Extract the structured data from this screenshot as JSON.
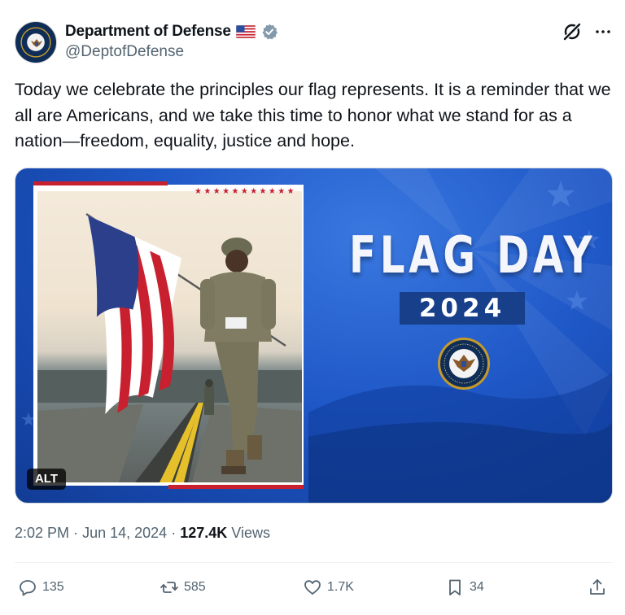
{
  "account": {
    "display_name": "Department of Defense",
    "handle": "@DeptofDefense",
    "flag_emoji_icon": "us-flag-icon",
    "verified_icon": "verified-badge-icon",
    "verified_color": "#829aab"
  },
  "tweet": {
    "text": "Today we celebrate the principles our flag represents. It is a reminder that we all are Americans, and we take this time to honor what we stand for as a nation—freedom, equality, justice and hope."
  },
  "media": {
    "headline": "FLAG DAY",
    "year": "2024",
    "alt_label": "ALT",
    "background_color": "#1f58c7",
    "seal_icon": "dod-seal-icon"
  },
  "meta": {
    "time": "2:02 PM",
    "separator": "·",
    "date": "Jun 14, 2024",
    "views_count": "127.4K",
    "views_label": "Views"
  },
  "actions": {
    "replies": "135",
    "reposts": "585",
    "likes": "1.7K",
    "bookmarks": "34"
  },
  "colors": {
    "text": "#0f1419",
    "secondary": "#536471",
    "accent_red": "#c8202f"
  }
}
